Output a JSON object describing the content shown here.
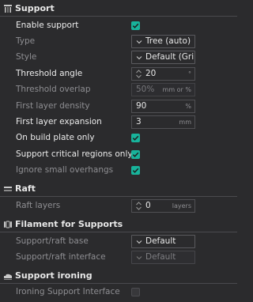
{
  "sections": {
    "support": {
      "title": "Support",
      "icon": "support-icon"
    },
    "raft": {
      "title": "Raft",
      "icon": "raft-icon"
    },
    "filament": {
      "title": "Filament for Supports",
      "icon": "filament-icon"
    },
    "ironing": {
      "title": "Support ironing",
      "icon": "ironing-icon"
    }
  },
  "support": {
    "enable_support": {
      "label": "Enable support",
      "checked": true
    },
    "type": {
      "label": "Type",
      "value": "Tree (auto)"
    },
    "style": {
      "label": "Style",
      "value": "Default (Gri..."
    },
    "threshold_angle": {
      "label": "Threshold angle",
      "value": "20",
      "unit": "°"
    },
    "threshold_overlap": {
      "label": "Threshold overlap",
      "value": "50%",
      "unit": "mm or %"
    },
    "first_layer_density": {
      "label": "First layer density",
      "value": "90",
      "unit": "%"
    },
    "first_layer_expansion": {
      "label": "First layer expansion",
      "value": "3",
      "unit": "mm"
    },
    "on_build_plate_only": {
      "label": "On build plate only",
      "checked": true
    },
    "support_critical_regions": {
      "label": "Support critical regions only",
      "checked": true
    },
    "ignore_small_overhangs": {
      "label": "Ignore small overhangs",
      "checked": true
    }
  },
  "raft": {
    "raft_layers": {
      "label": "Raft layers",
      "value": "0",
      "unit": "layers"
    }
  },
  "filament": {
    "support_raft_base": {
      "label": "Support/raft base",
      "value": "Default"
    },
    "support_raft_interface": {
      "label": "Support/raft interface",
      "value": "Default"
    }
  },
  "ironing": {
    "ironing_support_interface": {
      "label": "Ironing Support Interface",
      "checked": false
    }
  },
  "colors": {
    "accent": "#18b39b",
    "background": "#2b2b2d"
  }
}
